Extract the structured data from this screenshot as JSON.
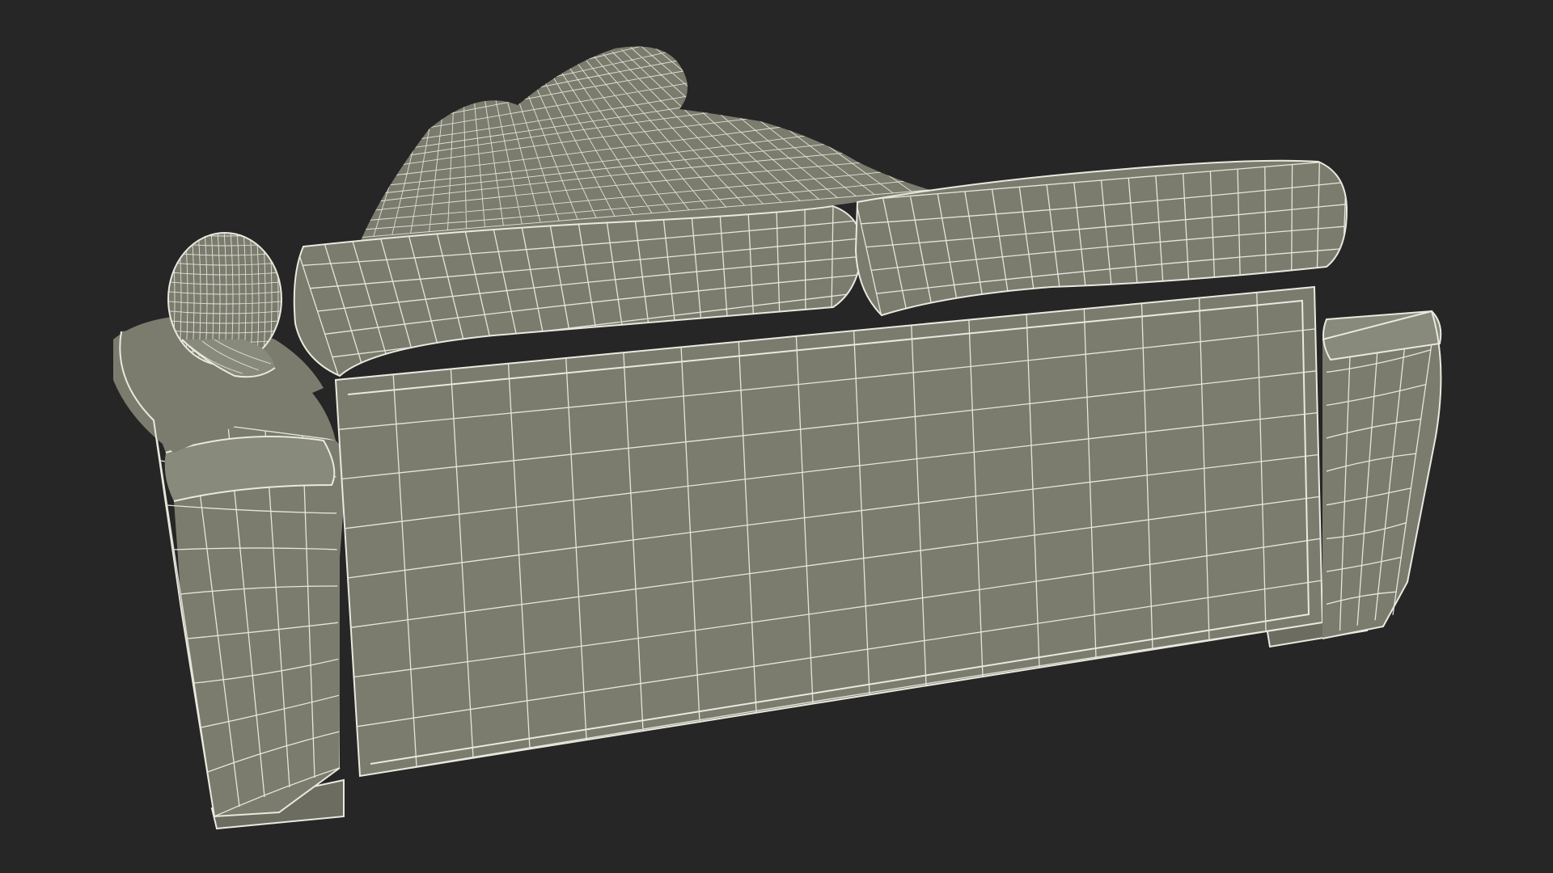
{
  "scene": {
    "background_color": "#262626",
    "mesh_fill_color": "#7b7c6e",
    "wire_color": "#ecece2",
    "subject": "wireframe-render"
  }
}
